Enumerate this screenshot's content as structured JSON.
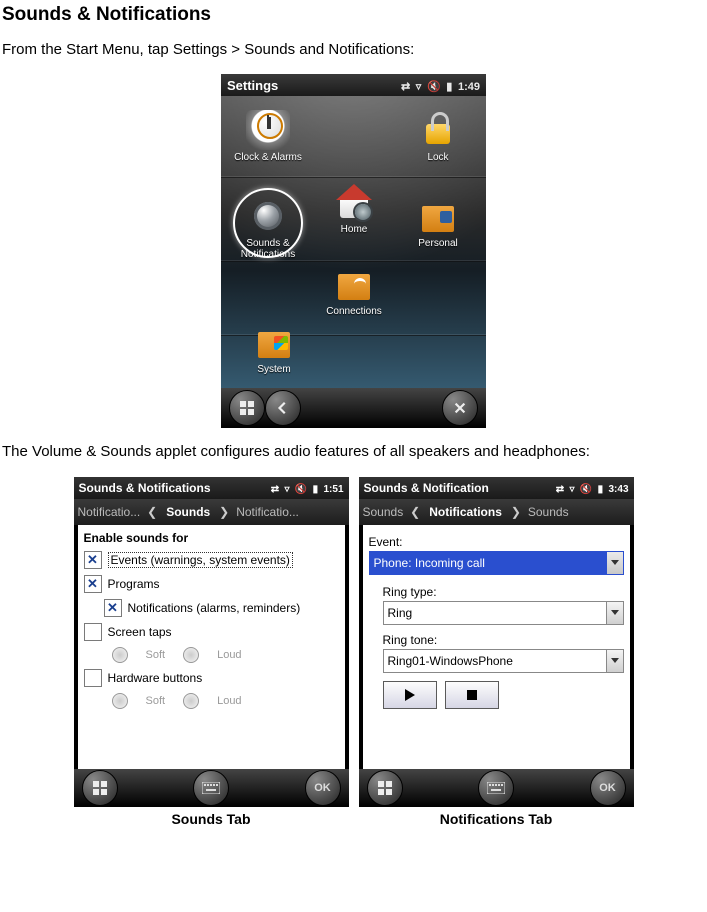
{
  "doc": {
    "heading": "Sounds & Notifications",
    "intro": "From the Start Menu, tap Settings > Sounds and Notifications:",
    "outro": "The Volume & Sounds applet configures audio features of all speakers and headphones:"
  },
  "settings_screen": {
    "title": "Settings",
    "clock": "1:49",
    "items": {
      "clock_alarms": "Clock & Alarms",
      "lock": "Lock",
      "home": "Home",
      "sounds_notifications": "Sounds &\nNotifications",
      "personal": "Personal",
      "connections": "Connections",
      "system": "System"
    }
  },
  "sounds_tab": {
    "title": "Sounds & Notifications",
    "clock": "1:51",
    "nav": {
      "left": "Notificatio...",
      "center": "Sounds",
      "right": "Notificatio..."
    },
    "section_header": "Enable sounds for",
    "items": {
      "events": {
        "label": "Events (warnings, system events)",
        "checked": true,
        "selected": true
      },
      "programs": {
        "label": "Programs",
        "checked": true
      },
      "notifications": {
        "label": "Notifications (alarms, reminders)",
        "checked": true,
        "indent": true
      },
      "screen_taps": {
        "label": "Screen taps",
        "checked": false
      },
      "hardware_buttons": {
        "label": "Hardware buttons",
        "checked": false
      }
    },
    "radio": {
      "soft": "Soft",
      "loud": "Loud"
    },
    "caption": "Sounds Tab"
  },
  "notifications_tab": {
    "title": "Sounds & Notification",
    "clock": "3:43",
    "nav": {
      "left": "Sounds",
      "center": "Notifications",
      "right": "Sounds"
    },
    "fields": {
      "event_label": "Event:",
      "event_value": "Phone: Incoming call",
      "ring_type_label": "Ring type:",
      "ring_type_value": "Ring",
      "ring_tone_label": "Ring tone:",
      "ring_tone_value": "Ring01-WindowsPhone"
    },
    "caption": "Notifications Tab"
  }
}
